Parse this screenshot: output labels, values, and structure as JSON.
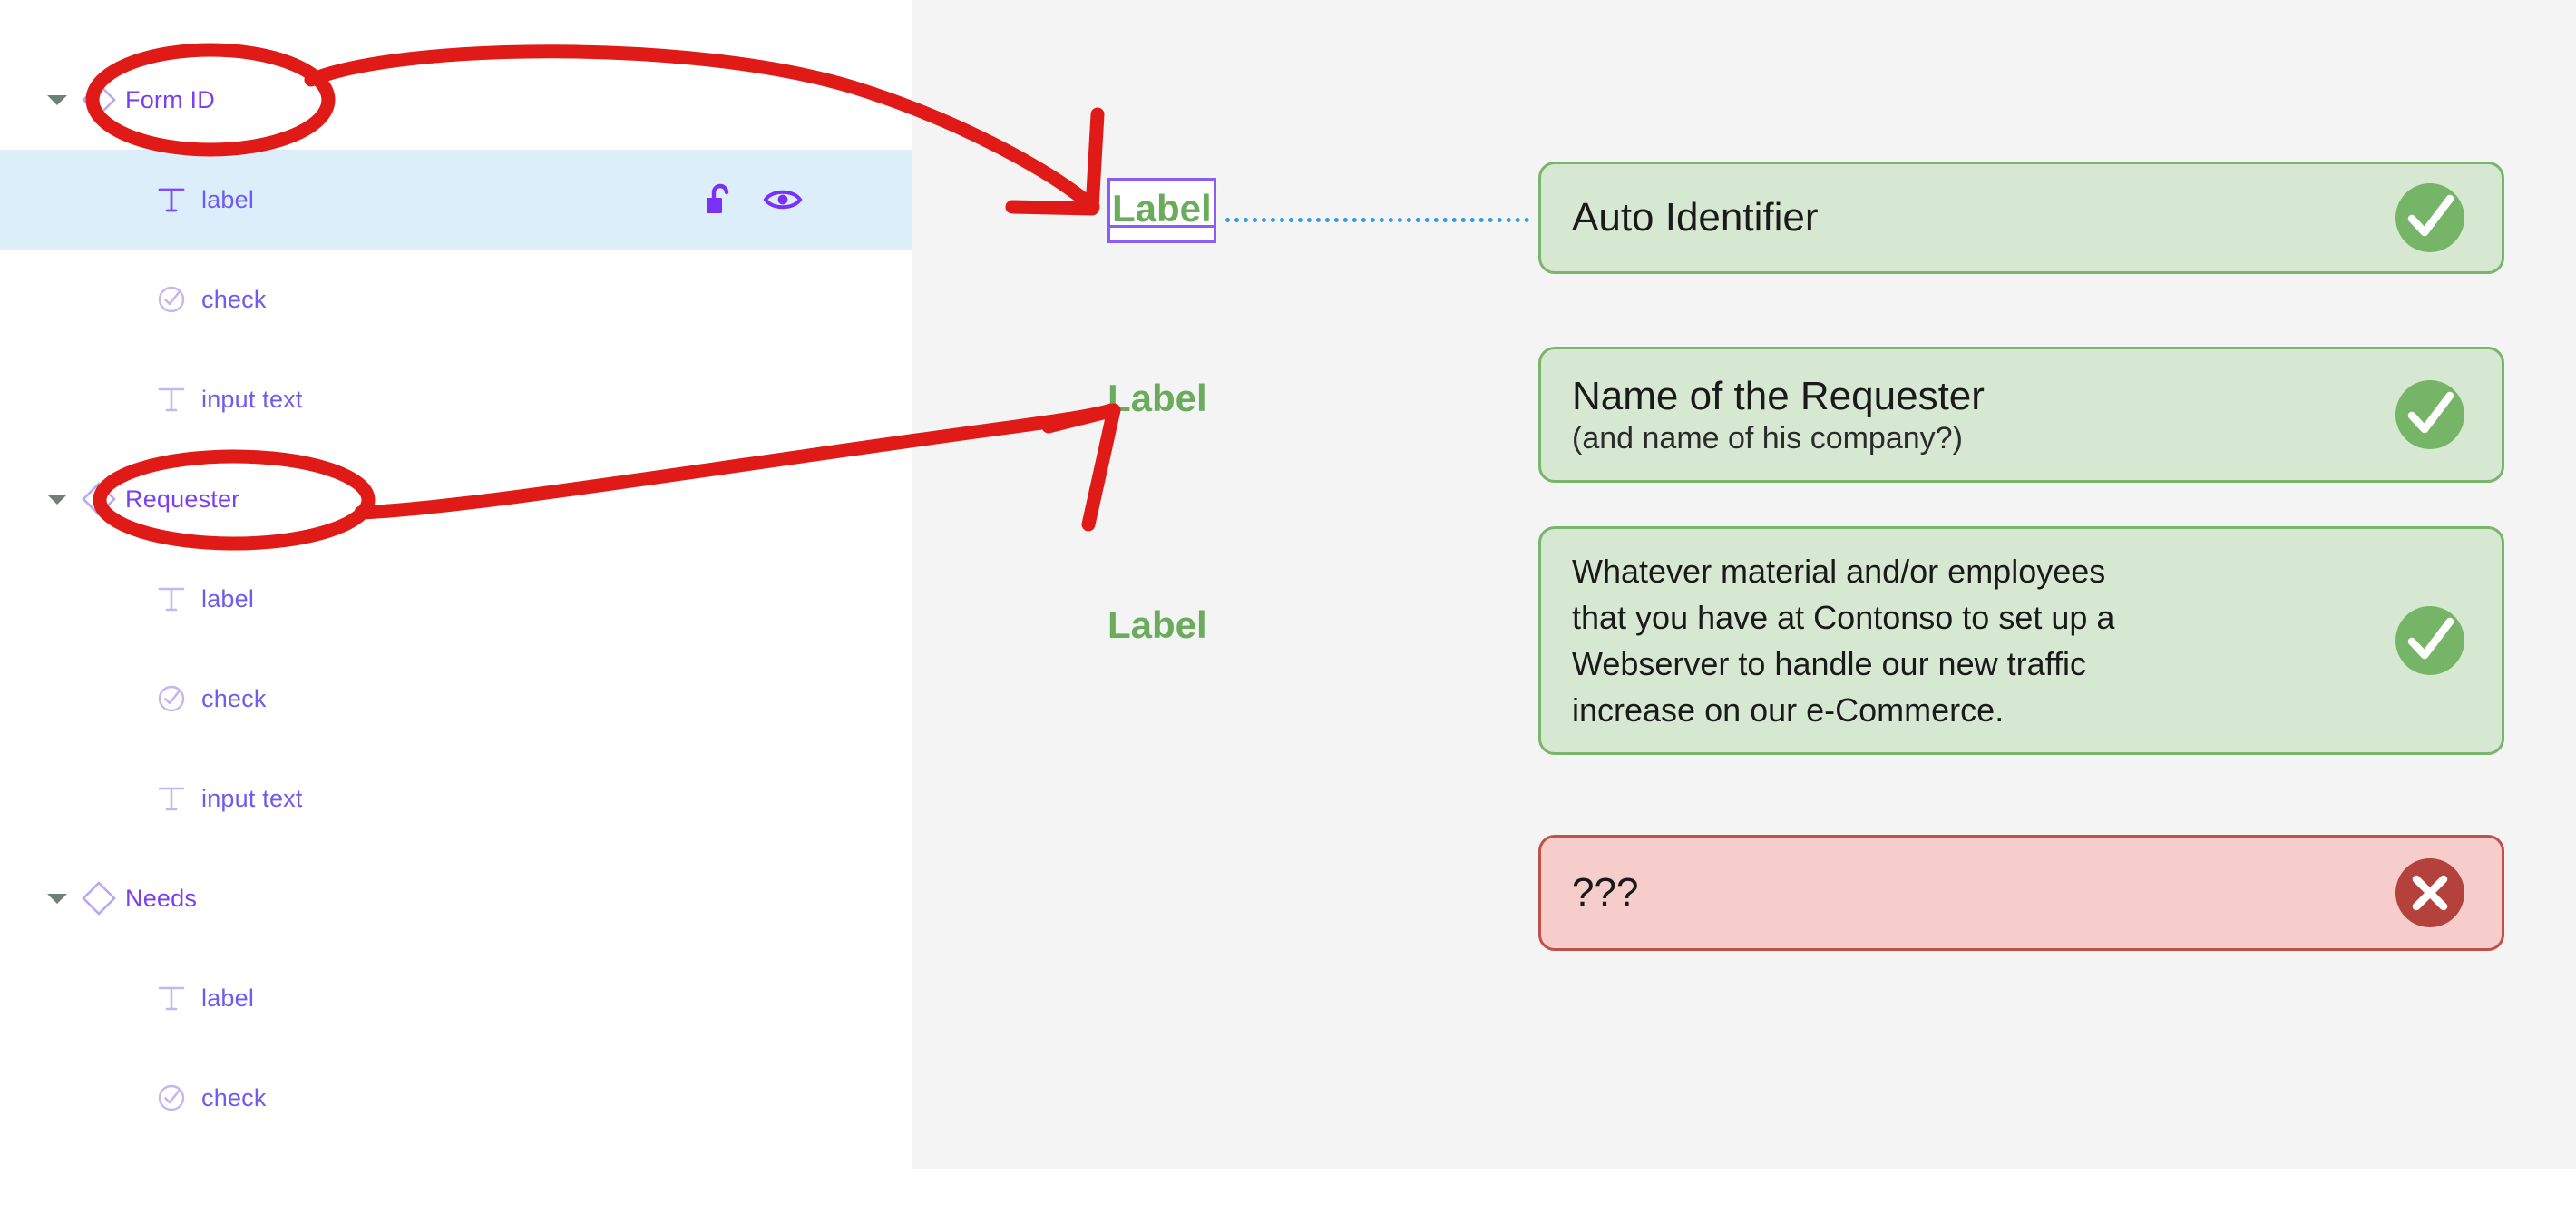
{
  "colors": {
    "annotation_red": "#e01b17",
    "selection_row_blue": "#ddeefb",
    "tree_text_purple": "#7c4dff",
    "caret_green": "#6d8275",
    "label_green": "#6aab5c",
    "field_ok_bg": "#d6e8d1",
    "field_ok_border": "#79b56b",
    "field_err_bg": "#f6cdcb",
    "field_err_border": "#c0504a",
    "badge_ok": "#76b568",
    "badge_err": "#b5413c",
    "connector_blue": "#2f9de4",
    "selection_outline_purple": "#8b5cf6",
    "pane_bg": "#f4f4f4"
  },
  "layer_tree": {
    "items": [
      {
        "label": "Form ID",
        "icon": "diamond-icon",
        "level": 0,
        "expanded": true,
        "selected": false,
        "annotated": true
      },
      {
        "label": "label",
        "icon": "text-type-icon",
        "level": 1,
        "expanded": false,
        "selected": true,
        "annotated": false
      },
      {
        "label": "check",
        "icon": "check-shield-icon",
        "level": 1,
        "expanded": false,
        "selected": false,
        "annotated": false
      },
      {
        "label": "input text",
        "icon": "text-type-icon",
        "level": 1,
        "expanded": false,
        "selected": false,
        "annotated": false
      },
      {
        "label": "Requester",
        "icon": "diamond-icon",
        "level": 0,
        "expanded": true,
        "selected": false,
        "annotated": true
      },
      {
        "label": "label",
        "icon": "text-type-icon",
        "level": 1,
        "expanded": false,
        "selected": false,
        "annotated": false
      },
      {
        "label": "check",
        "icon": "check-shield-icon",
        "level": 1,
        "expanded": false,
        "selected": false,
        "annotated": false
      },
      {
        "label": "input text",
        "icon": "text-type-icon",
        "level": 1,
        "expanded": false,
        "selected": false,
        "annotated": false
      },
      {
        "label": "Needs",
        "icon": "diamond-icon",
        "level": 0,
        "expanded": true,
        "selected": false,
        "annotated": false
      },
      {
        "label": "label",
        "icon": "text-type-icon",
        "level": 1,
        "expanded": false,
        "selected": false,
        "annotated": false
      },
      {
        "label": "check",
        "icon": "check-shield-icon",
        "level": 1,
        "expanded": false,
        "selected": false,
        "annotated": false
      }
    ],
    "selected_row_actions": [
      {
        "icon": "unlock-icon",
        "name": "lock-toggle"
      },
      {
        "icon": "eye-icon",
        "name": "visibility-toggle"
      }
    ]
  },
  "preview": {
    "rows": [
      {
        "label": "Label",
        "label_selected": true,
        "connector": true,
        "value": "Auto Identifier",
        "sub": "",
        "status": "ok",
        "status_icon": "check-circle-icon"
      },
      {
        "label": "Label",
        "label_selected": false,
        "connector": false,
        "value": "Name of the Requester",
        "sub": "(and name of his company?)",
        "status": "ok",
        "status_icon": "check-circle-icon"
      },
      {
        "label": "Label",
        "label_selected": false,
        "connector": false,
        "value": "Whatever material and/or employees\nthat you have at Contonso to set up a\nWebserver to handle our new traffic\nincrease on our e-Commerce.",
        "sub": "",
        "status": "ok",
        "status_icon": "check-circle-icon"
      },
      {
        "label": "",
        "label_selected": false,
        "connector": false,
        "value": "???",
        "sub": "",
        "status": "err",
        "status_icon": "x-circle-icon"
      }
    ]
  },
  "annotations": {
    "circles": [
      {
        "target": "Form ID",
        "name": "annotation-circle-form-id"
      },
      {
        "target": "Requester",
        "name": "annotation-circle-requester"
      }
    ],
    "arrows": [
      {
        "from": "Form ID",
        "to": "Label",
        "name": "annotation-arrow-form-id-to-label"
      },
      {
        "from": "Requester",
        "to": "Label",
        "name": "annotation-arrow-requester-to-label"
      }
    ]
  }
}
